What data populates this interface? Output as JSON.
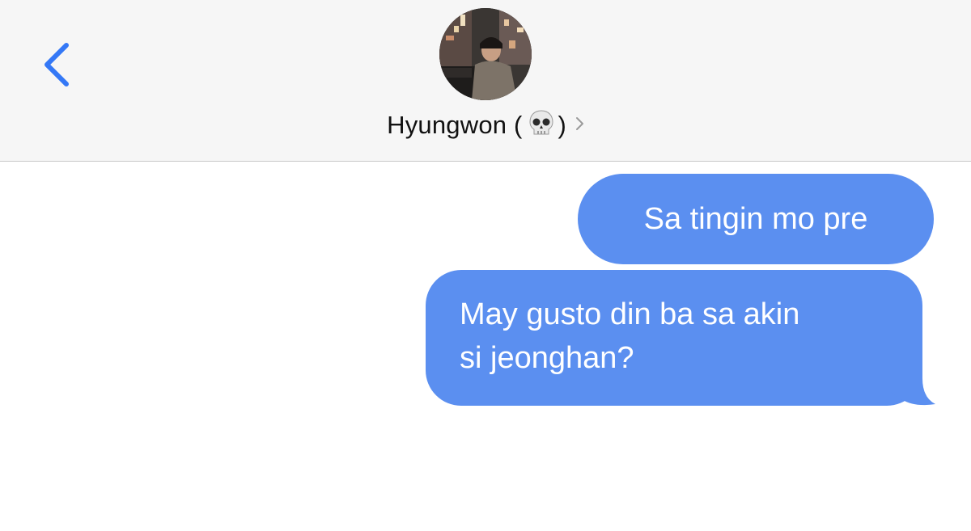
{
  "header": {
    "back_icon": "chevron-left-icon",
    "avatar_alt": "contact-photo",
    "contact_name": "Hyungwon (",
    "contact_emoji": "💀",
    "contact_name_close": ")",
    "details_icon": "chevron-right-icon"
  },
  "messages": [
    {
      "direction": "outgoing",
      "text": "Sa tingin mo pre"
    },
    {
      "direction": "outgoing",
      "text": "May gusto din ba sa akin\nsi jeonghan?"
    }
  ],
  "colors": {
    "accent": "#3478f6",
    "bubble_outgoing": "#5b8ff0",
    "header_bg": "#f6f6f6",
    "divider": "#c9c9c9"
  }
}
